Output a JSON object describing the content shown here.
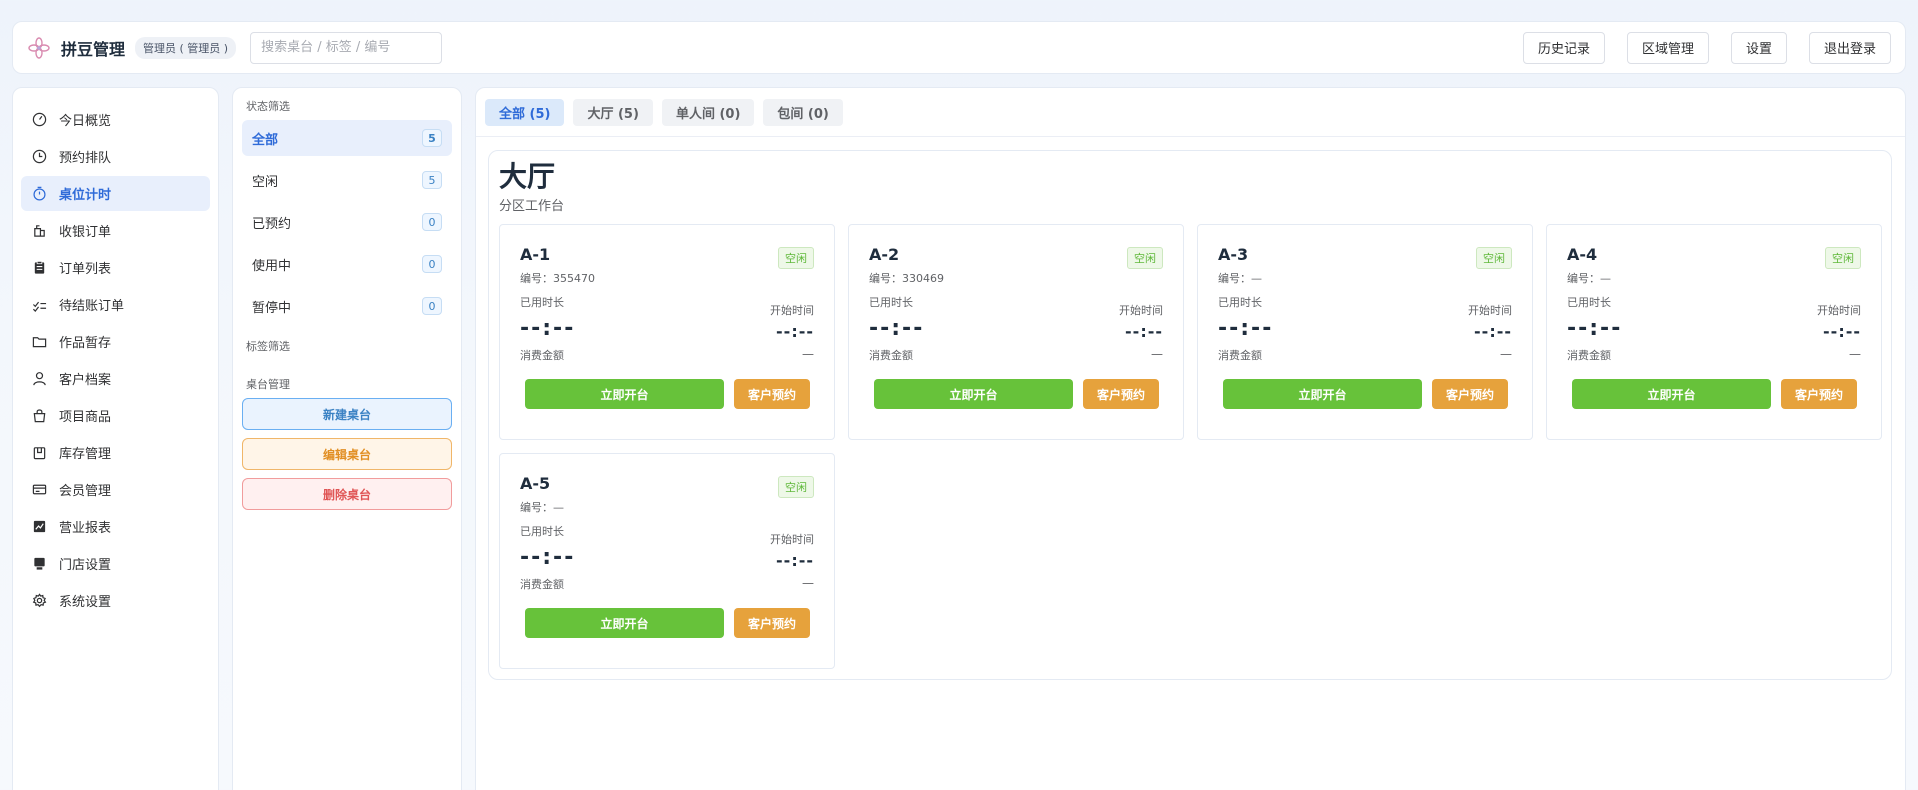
{
  "header": {
    "brand": "拼豆管理",
    "role_badge": "管理员 ( 管理员 )",
    "search_placeholder": "搜索桌台 / 标签 / 编号",
    "actions": [
      "历史记录",
      "区域管理",
      "设置",
      "退出登录"
    ]
  },
  "sidebar": {
    "items": [
      {
        "label": "今日概览",
        "icon": "dashboard-icon"
      },
      {
        "label": "预约排队",
        "icon": "clock-icon"
      },
      {
        "label": "桌位计时",
        "icon": "stopwatch-icon",
        "active": true
      },
      {
        "label": "收银订单",
        "icon": "cashier-icon"
      },
      {
        "label": "订单列表",
        "icon": "clipboard-icon"
      },
      {
        "label": "待结账订单",
        "icon": "checklist-icon"
      },
      {
        "label": "作品暂存",
        "icon": "folder-icon"
      },
      {
        "label": "客户档案",
        "icon": "user-icon"
      },
      {
        "label": "项目商品",
        "icon": "bag-icon"
      },
      {
        "label": "库存管理",
        "icon": "box-icon"
      },
      {
        "label": "会员管理",
        "icon": "card-icon"
      },
      {
        "label": "营业报表",
        "icon": "chart-icon"
      },
      {
        "label": "门店设置",
        "icon": "store-icon"
      },
      {
        "label": "系统设置",
        "icon": "gear-icon"
      }
    ]
  },
  "filters": {
    "status_title": "状态筛选",
    "status": [
      {
        "label": "全部",
        "count": "5",
        "active": true
      },
      {
        "label": "空闲",
        "count": "5"
      },
      {
        "label": "已预约",
        "count": "0"
      },
      {
        "label": "使用中",
        "count": "0"
      },
      {
        "label": "暂停中",
        "count": "0"
      }
    ],
    "tag_title": "标签筛选",
    "mgmt_title": "桌台管理",
    "new_table": "新建桌台",
    "edit_table": "编辑桌台",
    "delete_table": "删除桌台"
  },
  "tabs": [
    {
      "label": "全部 (5)",
      "active": true
    },
    {
      "label": "大厅 (5)"
    },
    {
      "label": "单人间 (0)"
    },
    {
      "label": "包间 (0)"
    }
  ],
  "zone": {
    "title": "大厅",
    "subtitle": "分区工作台",
    "labels": {
      "duration": "已用时长",
      "start": "开始时间",
      "amount": "消费金额",
      "open_btn": "立即开台",
      "book_btn": "客户预约"
    },
    "tables": [
      {
        "name": "A-1",
        "code": "编号：355470",
        "status": "空闲",
        "duration": "--:--",
        "start": "--:--",
        "amount": "—"
      },
      {
        "name": "A-2",
        "code": "编号：330469",
        "status": "空闲",
        "duration": "--:--",
        "start": "--:--",
        "amount": "—"
      },
      {
        "name": "A-3",
        "code": "编号：—",
        "status": "空闲",
        "duration": "--:--",
        "start": "--:--",
        "amount": "—"
      },
      {
        "name": "A-4",
        "code": "编号：—",
        "status": "空闲",
        "duration": "--:--",
        "start": "--:--",
        "amount": "—"
      },
      {
        "name": "A-5",
        "code": "编号：—",
        "status": "空闲",
        "duration": "--:--",
        "start": "--:--",
        "amount": "—"
      }
    ]
  },
  "colors": {
    "accent": "#2f6bd8",
    "open_green": "#67c23a",
    "book_orange": "#e6a23c",
    "idle_green": "#5fb83a"
  }
}
